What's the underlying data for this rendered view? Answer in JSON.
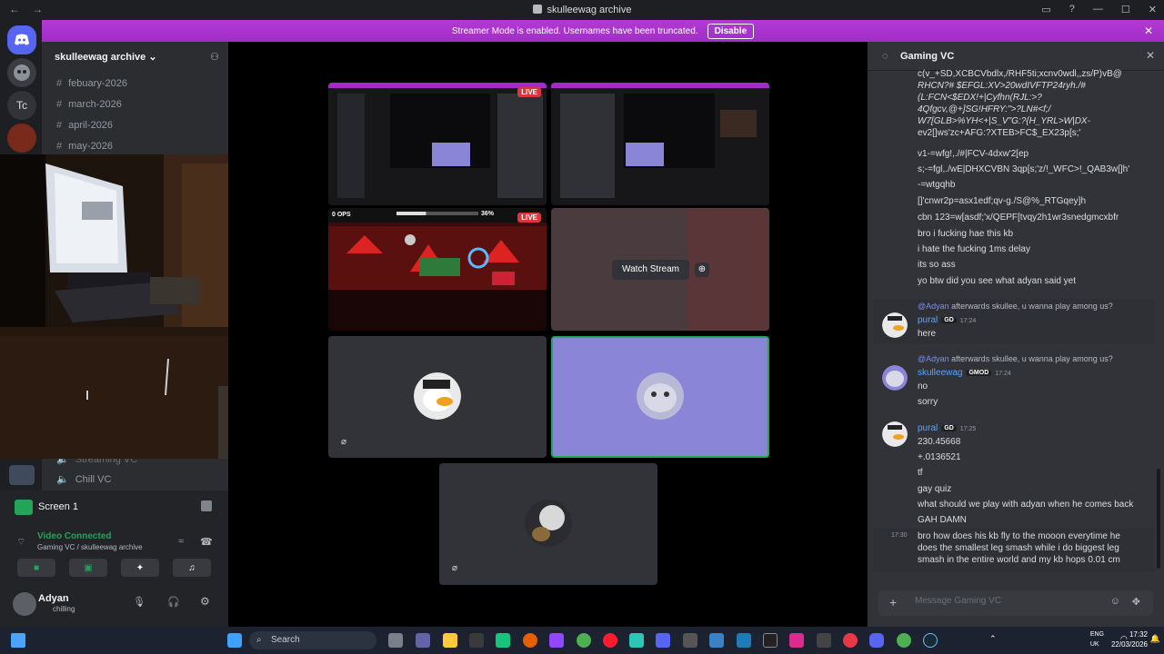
{
  "titlebar": {
    "title": "skulleewag archive",
    "back": "←",
    "forward": "→",
    "controls": [
      "▭",
      "?",
      "—",
      "☐",
      "✕"
    ]
  },
  "banner": {
    "text": "Streamer Mode is enabled. Usernames have been truncated.",
    "button": "Disable",
    "close": "✕"
  },
  "rail": {
    "items": [
      "Tc"
    ]
  },
  "sidebar": {
    "server_name": "skulleewag archive ⌄",
    "channels": [
      {
        "name": "febuary-2026"
      },
      {
        "name": "march-2026"
      },
      {
        "name": "april-2026"
      },
      {
        "name": "may-2026"
      }
    ],
    "voice_channels": [
      {
        "name": "Streaming VC"
      },
      {
        "name": "Chill VC"
      }
    ]
  },
  "screen_share": {
    "label": "Screen 1"
  },
  "voice_status": {
    "status": "Video Connected",
    "location": "Gaming VC / skulleewag archive"
  },
  "user_panel": {
    "name": "Adyan",
    "status": "chilling"
  },
  "stage": {
    "live_label": "LIVE",
    "game_ops": "0 OPS",
    "game_progress": "36%",
    "game_progress_value": 0.36,
    "watch_button": "Watch Stream"
  },
  "chat": {
    "channel": "Gaming VC",
    "lines_top": [
      "c(v_+SD,XCBCVbdlx,/RHF5ti;xcnv0wdl,,zs/P)vB@",
      "RHCN?# $EFGL:XV>20wdIVFTP24ryh./#",
      "(L:FCN<$EDX!+|Cyfhn(RJL:>?",
      "4Qfgcv,@+]SG!HFRY:\">?LN#<f;/",
      "W7[GLB>%YH<+|S_V\"G:?{H_YRL>W|DX-",
      "ev2[]ws'zc+AFG:?XTEB>FC$_EX23p[s;'",
      "v1-=wfg!,./#|FCV-4dxw'2[ep",
      "s;-=fgl,./wE|DHXCVBN 3qp[s;'z/!_WFC>!_QAB3w[]h'",
      "-=wtgqhb",
      "[]'cnwr2p=asx1edf;qv-g./S@%_RTGqey]h",
      "cbn 123=w[asdf;'x/QEPF[tvqy2h1wr3snedgmcxbfr",
      "bro i fucking hae this kb",
      "i hate the fucking 1ms delay",
      "its so ass",
      "yo btw did you see what adyan said yet"
    ],
    "messages": [
      {
        "reply_to": "@Adyan",
        "reply_text": "afterwards skullee, u wanna play among us?",
        "author": "pural",
        "badge": "GD",
        "time": "17:24",
        "lines": [
          "here"
        ]
      },
      {
        "reply_to": "@Adyan",
        "reply_text": "afterwards skullee, u wanna play among us?",
        "author": "skulleewag",
        "badge": "GMOD",
        "time": "17:24",
        "lines": [
          "no",
          "sorry"
        ]
      },
      {
        "author": "pural",
        "badge": "GD",
        "time": "17:25",
        "lines": [
          "230.45668",
          "+.0136521",
          "tf",
          "gay quiz",
          "what should we play with adyan when he comes back",
          "GAH DAMN"
        ]
      }
    ],
    "last_message": {
      "time": "17:30",
      "text": "bro how does his kb fly to the mooon everytime he does the smallest leg smash while i do biggest leg smash in the entire world and my kb hops 0.01 cm"
    },
    "input_placeholder": "Message Gaming VC"
  },
  "taskbar": {
    "search": "Search",
    "lang_top": "ENG",
    "lang_bottom": "UK",
    "time": "17:32",
    "date": "22/03/2026"
  },
  "colors": {
    "accent": "#5865f2",
    "banner": "#a42bc9",
    "green": "#23a559",
    "live": "#da373c",
    "highlight": "#8a85d6"
  }
}
